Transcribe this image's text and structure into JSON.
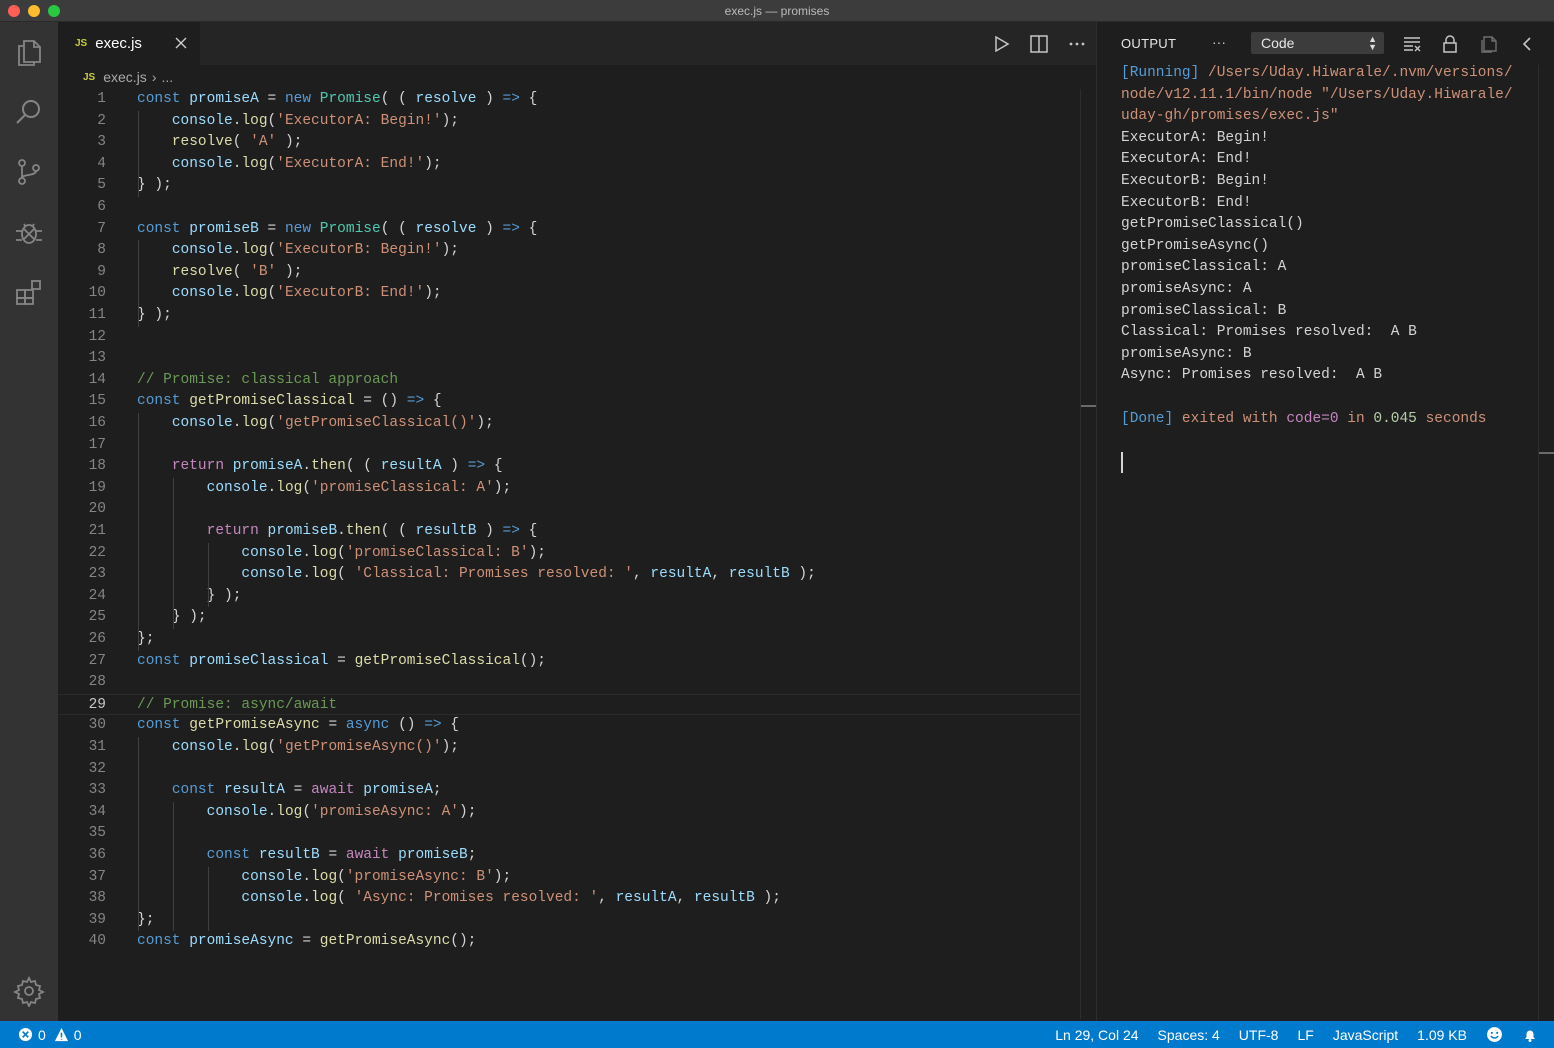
{
  "window": {
    "title": "exec.js — promises"
  },
  "editor": {
    "tab": {
      "badge": "JS",
      "label": "exec.js"
    },
    "breadcrumb": {
      "badge": "JS",
      "file": "exec.js",
      "separator": "›",
      "ellipsis": "..."
    },
    "current_line": 29,
    "lines": [
      "1",
      "2",
      "3",
      "4",
      "5",
      "6",
      "7",
      "8",
      "9",
      "10",
      "11",
      "12",
      "13",
      "14",
      "15",
      "16",
      "17",
      "18",
      "19",
      "20",
      "21",
      "22",
      "23",
      "24",
      "25",
      "26",
      "27",
      "28",
      "29",
      "30",
      "31",
      "32",
      "33",
      "34",
      "35",
      "36",
      "37",
      "38",
      "39",
      "40"
    ],
    "tokens": {
      "const": "const",
      "new": "new",
      "Promise": "Promise",
      "console": "console",
      "log": "log",
      "return": "return",
      "then": "then",
      "async": "async",
      "await": "await",
      "promiseA": "promiseA",
      "promiseB": "promiseB",
      "resolve": "resolve",
      "resultA": "resultA",
      "resultB": "resultB",
      "getPromiseClassical": "getPromiseClassical",
      "getPromiseAsync": "getPromiseAsync",
      "promiseClassical": "promiseClassical",
      "promiseAsync": "promiseAsync",
      "s_execA_begin": "'ExecutorA: Begin!'",
      "s_A": "'A'",
      "s_execA_end": "'ExecutorA: End!'",
      "s_execB_begin": "'ExecutorB: Begin!'",
      "s_B": "'B'",
      "s_execB_end": "'ExecutorB: End!'",
      "c_classical": "// Promise: classical approach",
      "s_getPromiseClassical": "'getPromiseClassical()'",
      "s_promiseClassical_A": "'promiseClassical: A'",
      "s_promiseClassical_B": "'promiseClassical: B'",
      "s_classical_resolved": "'Classical: Promises resolved: '",
      "c_async": "// Promise: async/await",
      "s_getPromiseAsync": "'getPromiseAsync()'",
      "s_promiseAsync_A": "'promiseAsync: A'",
      "s_promiseAsync_B": "'promiseAsync: B'",
      "s_async_resolved": "'Async: Promises resolved: '"
    }
  },
  "panel": {
    "title": "OUTPUT",
    "more": "···",
    "channel_select": "Code",
    "output": {
      "running_tag": "[Running]",
      "running_path_1": " /Users/Uday.Hiwarale/.nvm/versions/",
      "running_path_2": "node/v12.11.1/bin/node \"/Users/Uday.Hiwarale/",
      "running_path_3": "uday-gh/promises/exec.js\"",
      "lines": [
        "ExecutorA: Begin!",
        "ExecutorA: End!",
        "ExecutorB: Begin!",
        "ExecutorB: End!",
        "getPromiseClassical()",
        "getPromiseAsync()",
        "promiseClassical: A",
        "promiseAsync: A",
        "promiseClassical: B",
        "Classical: Promises resolved:  A B",
        "promiseAsync: B",
        "Async: Promises resolved:  A B"
      ],
      "done_tag": "[Done]",
      "done_exited": " exited with ",
      "done_code": "code=0",
      "done_in": " in ",
      "done_time": "0.045",
      "done_seconds": " seconds"
    }
  },
  "statusbar": {
    "errors": "0",
    "warnings": "0",
    "position": "Ln 29, Col 24",
    "spaces": "Spaces: 4",
    "encoding": "UTF-8",
    "eol": "LF",
    "language": "JavaScript",
    "size": "1.09 KB"
  },
  "icons": {
    "activity": [
      "files-icon",
      "search-icon",
      "source-control-icon",
      "debug-icon",
      "extensions-icon",
      "settings-gear-icon"
    ],
    "editor_actions": [
      "run-icon",
      "split-editor-icon",
      "more-actions-icon"
    ],
    "panel_actions": [
      "clear-output-icon",
      "lock-scroll-icon",
      "open-log-icon",
      "collapse-panel-icon"
    ],
    "statusbar": [
      "error-icon",
      "warning-icon",
      "feedback-smiley-icon",
      "notifications-bell-icon"
    ]
  },
  "colors": {
    "keyword": "#569cd6",
    "control": "#c586c0",
    "variable": "#9cdcfe",
    "function": "#dcdcaa",
    "class": "#4ec9b0",
    "string": "#ce9178",
    "comment": "#6a9955",
    "statusbar": "#007acc"
  }
}
